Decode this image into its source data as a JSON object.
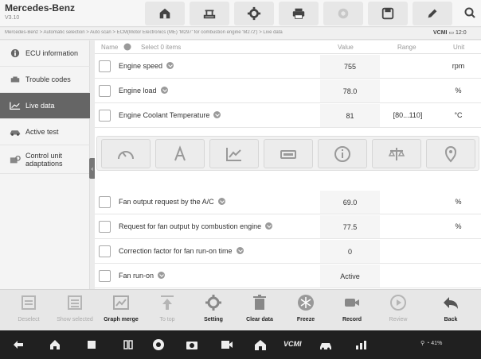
{
  "header": {
    "brand": "Mercedes-Benz",
    "version": "V3.10"
  },
  "breadcrumb": "Mercedes-Benz > Automatic selection > Auto scan > ECM(Motor Electronics (ME) 'M297' for combustion engine 'M272') > Live data",
  "status": {
    "vcm": "VCMI",
    "time": "12:0"
  },
  "sidebar": {
    "items": [
      {
        "label": "ECU information",
        "icon": "info-icon"
      },
      {
        "label": "Trouble codes",
        "icon": "engine-icon"
      },
      {
        "label": "Live data",
        "icon": "line-chart-icon"
      },
      {
        "label": "Active test",
        "icon": "car-test-icon"
      },
      {
        "label": "Control unit\nadaptations",
        "icon": "adaptation-icon"
      }
    ],
    "active_index": 2
  },
  "table": {
    "headers": {
      "name": "Name",
      "selected": "Select 0 items",
      "value": "Value",
      "range": "Range",
      "unit": "Unit"
    },
    "rows": [
      {
        "name": "Engine speed",
        "value": "755",
        "range": "",
        "unit": "rpm"
      },
      {
        "name": "Engine load",
        "value": "78.0",
        "range": "",
        "unit": "%"
      },
      {
        "name": "Engine Coolant Temperature",
        "value": "81",
        "range": "[80...110]",
        "unit": "°C"
      },
      {
        "name": "Fan output request by the A/C",
        "value": "69.0",
        "range": "",
        "unit": "%"
      },
      {
        "name": "Request for fan output by combustion engine",
        "value": "77.5",
        "range": "",
        "unit": "%"
      },
      {
        "name": "Correction factor for fan run-on time",
        "value": "0",
        "range": "",
        "unit": ""
      },
      {
        "name": "Fan run-on",
        "value": "Active",
        "range": "",
        "unit": ""
      }
    ]
  },
  "graph_modes": [
    "gauge-icon",
    "text-icon",
    "waveform-icon",
    "digital-icon",
    "info-circle-icon",
    "compare-icon",
    "pin-icon"
  ],
  "toolbar": {
    "buttons": [
      {
        "label": "Deselect",
        "enabled": false,
        "icon": "deselect-icon"
      },
      {
        "label": "Show selected",
        "enabled": false,
        "icon": "show-selected-icon"
      },
      {
        "label": "Graph merge",
        "enabled": true,
        "icon": "graph-merge-icon"
      },
      {
        "label": "To top",
        "enabled": false,
        "icon": "to-top-icon"
      },
      {
        "label": "Setting",
        "enabled": true,
        "icon": "setting-icon"
      },
      {
        "label": "Clear data",
        "enabled": true,
        "icon": "trash-icon"
      },
      {
        "label": "Freeze",
        "enabled": true,
        "icon": "freeze-icon"
      },
      {
        "label": "Record",
        "enabled": true,
        "icon": "record-icon"
      },
      {
        "label": "Review",
        "enabled": false,
        "icon": "review-icon"
      },
      {
        "label": "Back",
        "enabled": true,
        "icon": "back-icon"
      }
    ]
  },
  "system_bar": {
    "icons": [
      "back-arrow-icon",
      "home-icon",
      "square-icon",
      "columns-icon",
      "chrome-icon",
      "camera-icon",
      "screen-record-icon",
      "house-icon",
      "vcmi-icon",
      "car-icon",
      "network-icon"
    ],
    "vcmi_label": "VCMI",
    "status": "41%"
  },
  "colors": {
    "active_sidebar": "#656565",
    "toolbar_bg": "#e7e7e7",
    "sysbar_bg": "#202020"
  }
}
